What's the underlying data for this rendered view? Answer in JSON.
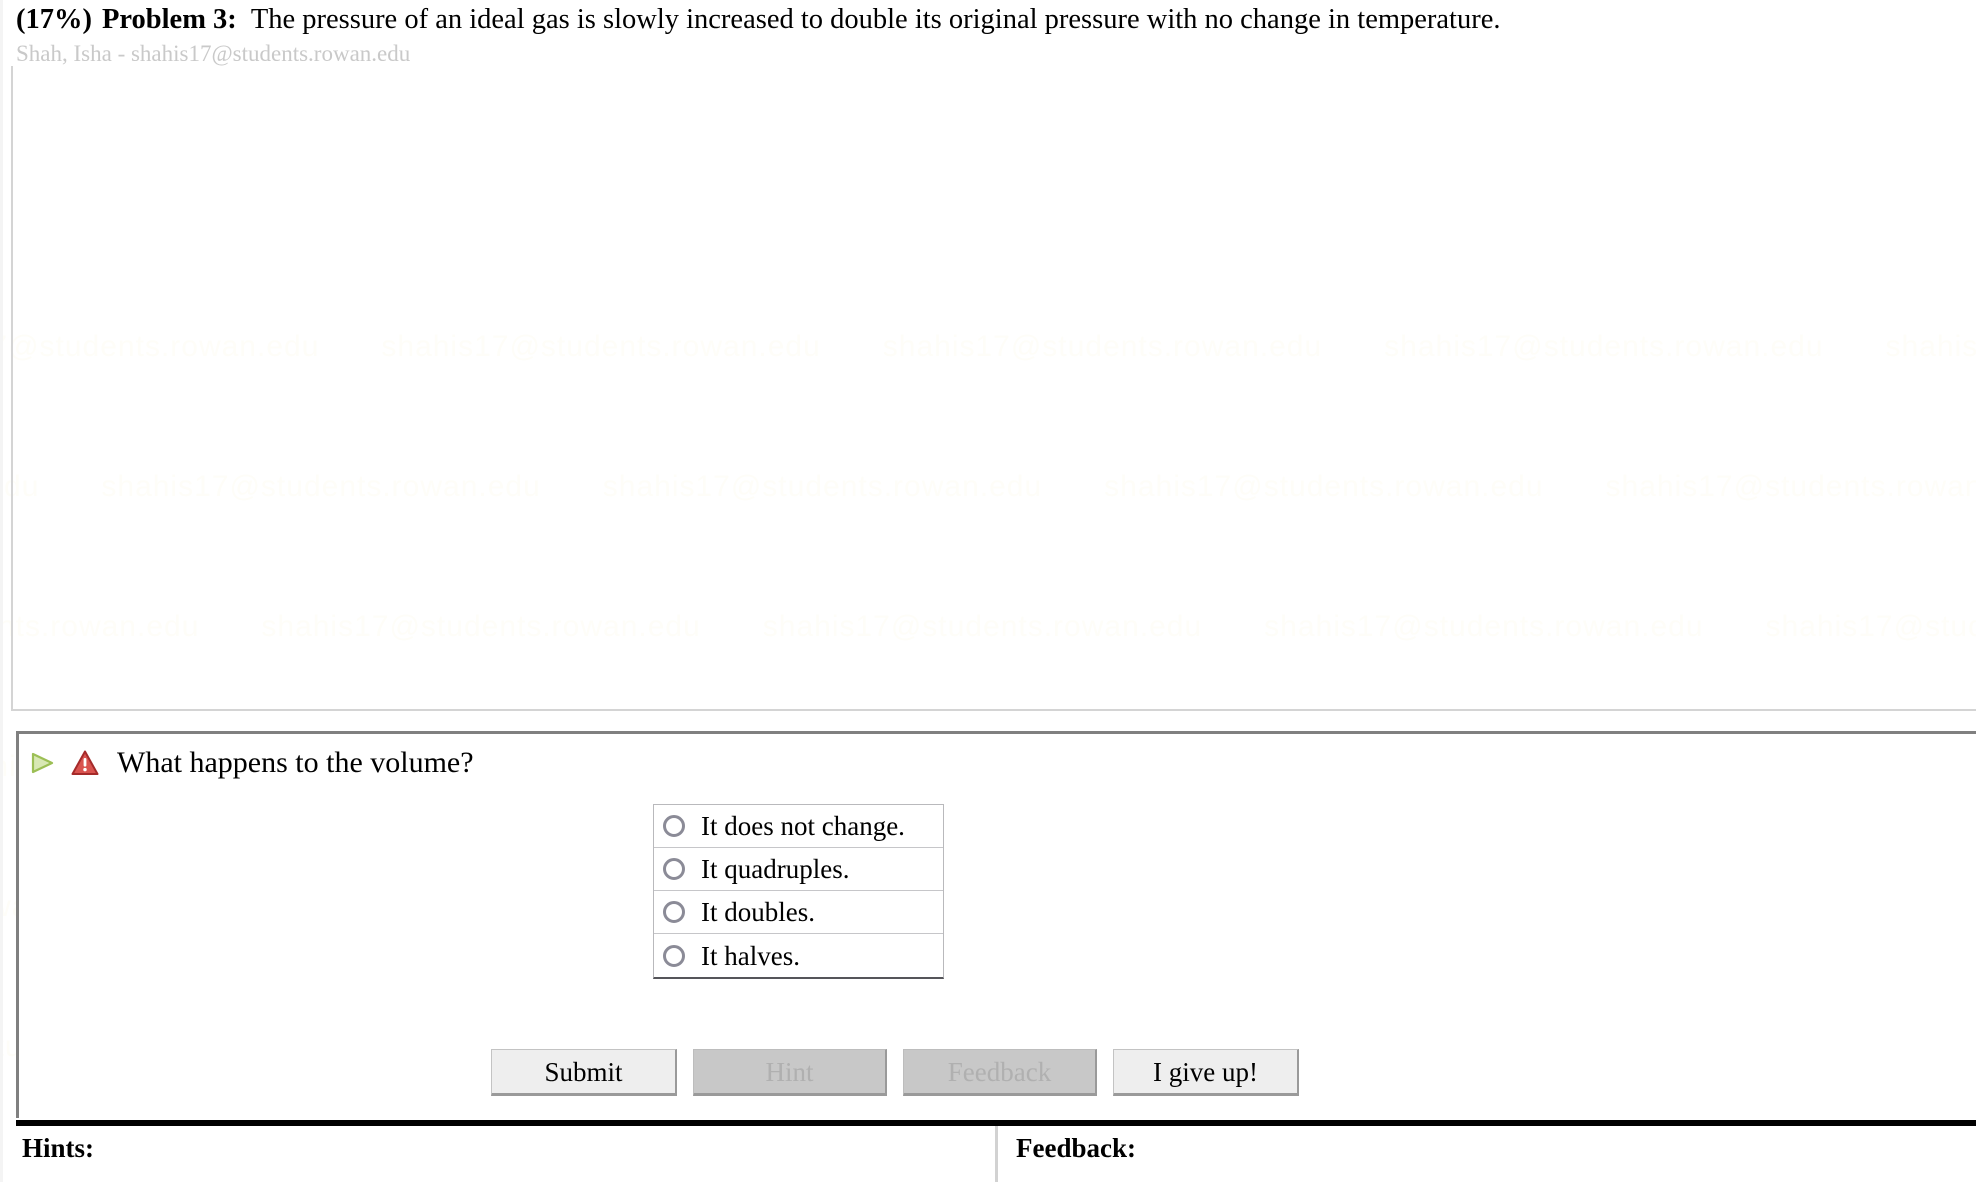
{
  "header": {
    "percent": "(17%)",
    "problem_number": "Problem 3:",
    "statement": "The pressure of an ideal gas is slowly increased to double its original pressure with no change in temperature.",
    "student": "Shah, Isha - shahis17@students.rowan.edu"
  },
  "watermark": {
    "text": "shahis17@students.rowan.edu"
  },
  "question": {
    "play_icon": "play-triangle-icon",
    "warning_icon": "warning-triangle-icon",
    "prompt": "What happens to the volume?",
    "choices": [
      {
        "label": "It does not change.",
        "selected": false
      },
      {
        "label": "It quadruples.",
        "selected": false
      },
      {
        "label": "It doubles.",
        "selected": false
      },
      {
        "label": "It halves.",
        "selected": false
      }
    ]
  },
  "buttons": {
    "submit": {
      "label": "Submit",
      "enabled": true
    },
    "hint": {
      "label": "Hint",
      "enabled": false
    },
    "feedback": {
      "label": "Feedback",
      "enabled": false
    },
    "giveup": {
      "label": "I give up!",
      "enabled": true
    }
  },
  "bottom": {
    "hints_label": "Hints:",
    "feedback_label": "Feedback:"
  },
  "colors": {
    "page_background": "#ffffff",
    "student_text": "#c9c9c9",
    "panel_border": "#d4d4d4",
    "question_border": "#808080",
    "radio_ring": "#8b8b97",
    "button_enabled": "#eeeeee",
    "button_disabled": "#c8c8c8",
    "button_disabled_text": "#b0b0b0",
    "bottom_rule": "#000000",
    "warning_icon": "#cc3333",
    "play_icon": "#a3c663"
  }
}
